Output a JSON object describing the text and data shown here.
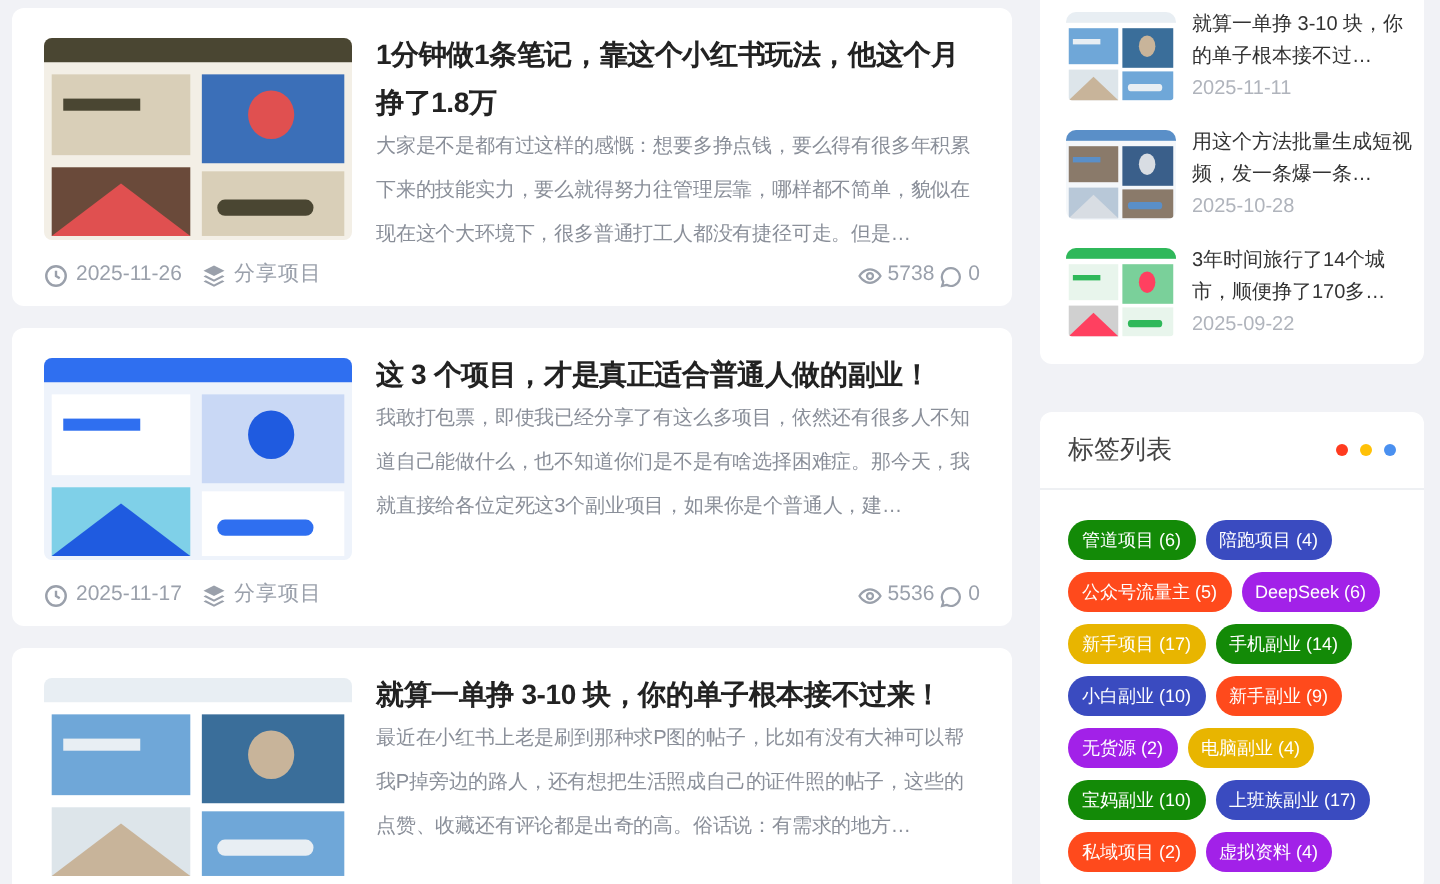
{
  "posts": [
    {
      "title": "1分钟做1条笔记，靠这个小红书玩法，他这个月挣了1.8万",
      "excerpt": "大家是不是都有过这样的感慨：想要多挣点钱，要么得有很多年积累下来的技能实力，要么就得努力往管理层靠，哪样都不简单，貌似在现在这个大环境下，很多普通打工人都没有捷径可走。但是…",
      "date": "2025-11-26",
      "category": "分享项目",
      "views": "5738",
      "comments": "0"
    },
    {
      "title": "这 3 个项目，才是真正适合普通人做的副业！",
      "excerpt": "我敢打包票，即使我已经分享了有这么多项目，依然还有很多人不知道自己能做什么，也不知道你们是不是有啥选择困难症。那今天，我就直接给各位定死这3个副业项目，如果你是个普通人，建…",
      "date": "2025-11-17",
      "category": "分享项目",
      "views": "5536",
      "comments": "0"
    },
    {
      "title": "就算一单挣 3-10 块，你的单子根本接不过来！",
      "excerpt": "最近在小红书上老是刷到那种求P图的帖子，比如有没有大神可以帮我P掉旁边的路人，还有想把生活照成自己的证件照的帖子，这些的点赞、收藏还有评论都是出奇的高。俗话说：有需求的地方…"
    }
  ],
  "recent": [
    {
      "title": "就算一单挣 3-10 块，你的单子根本接不过…",
      "date": "2025-11-11"
    },
    {
      "title": "用这个方法批量生成短视频，发一条爆一条…",
      "date": "2025-10-28"
    },
    {
      "title": "3年时间旅行了14个城市，顺便挣了170多…",
      "date": "2025-09-22"
    }
  ],
  "tag_panel": {
    "title": "标签列表",
    "dots": [
      {
        "color": "#ff3b1f"
      },
      {
        "color": "#ffc107"
      },
      {
        "color": "#4a90f0"
      }
    ],
    "tags": [
      {
        "label": "管道项目 (6)",
        "color": "#138a07"
      },
      {
        "label": "陪跑项目 (4)",
        "color": "#3a4bc0"
      },
      {
        "label": "公众号流量主 (5)",
        "color": "#ff4a1c"
      },
      {
        "label": "DeepSeek (6)",
        "color": "#a221e8"
      },
      {
        "label": "新手项目 (17)",
        "color": "#e8b500"
      },
      {
        "label": "手机副业 (14)",
        "color": "#138a07"
      },
      {
        "label": "小白副业 (10)",
        "color": "#3a4bc0"
      },
      {
        "label": "新手副业 (9)",
        "color": "#ff4a1c"
      },
      {
        "label": "无货源 (2)",
        "color": "#a221e8"
      },
      {
        "label": "电脑副业 (4)",
        "color": "#e8b500"
      },
      {
        "label": "宝妈副业 (10)",
        "color": "#138a07"
      },
      {
        "label": "上班族副业 (17)",
        "color": "#3a4bc0"
      },
      {
        "label": "私域项目 (2)",
        "color": "#ff4a1c"
      },
      {
        "label": "虚拟资料 (4)",
        "color": "#a221e8"
      }
    ]
  }
}
